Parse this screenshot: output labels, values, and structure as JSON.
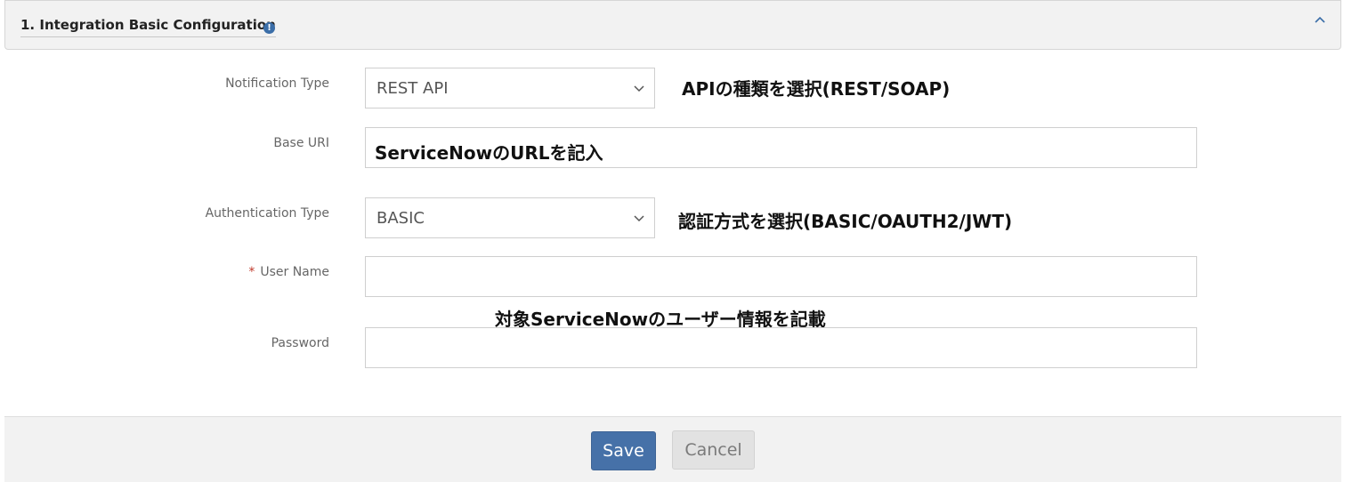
{
  "section": {
    "title": "1. Integration Basic Configuration",
    "info_icon": "!"
  },
  "form": {
    "notification_type": {
      "label": "Notification Type",
      "value": "REST API"
    },
    "base_uri": {
      "label": "Base URI",
      "value": "ServiceNowのURLを記入"
    },
    "authentication_type": {
      "label": "Authentication Type",
      "value": "BASIC"
    },
    "user_name": {
      "required_mark": "*",
      "label": "User Name",
      "value": ""
    },
    "password": {
      "label": "Password",
      "value": ""
    }
  },
  "annotations": {
    "api_type": "APIの種類を選択(REST/SOAP)",
    "auth_method": "認証方式を選択(BASIC/OAUTH2/JWT)",
    "user_info": "対象ServiceNowのユーザー情報を記載"
  },
  "footer": {
    "save_label": "Save",
    "cancel_label": "Cancel"
  },
  "colors": {
    "primary_button": "#4671a8",
    "info_icon": "#3b6ea8",
    "required": "#c0392b"
  }
}
